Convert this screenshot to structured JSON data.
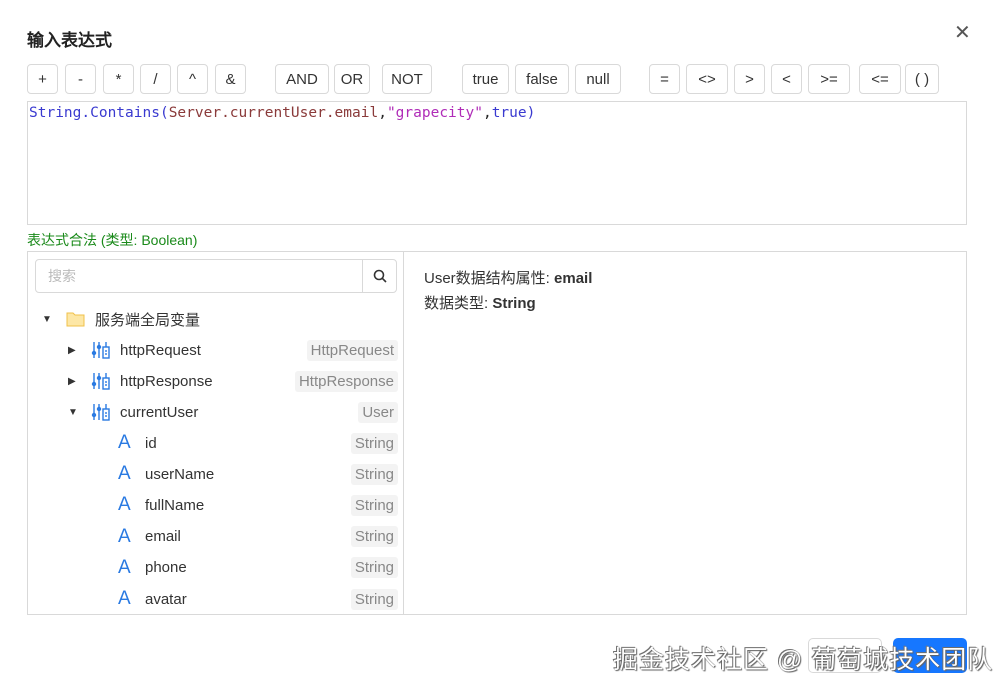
{
  "dialog": {
    "title": "输入表达式",
    "close_icon": "close-icon"
  },
  "operators": [
    "+",
    "-",
    "*",
    "/",
    "^",
    "&",
    "AND",
    "OR",
    "NOT",
    "true",
    "false",
    "null",
    "=",
    "<>",
    ">",
    "<",
    ">=",
    "<=",
    "( )"
  ],
  "expression": {
    "fn": "String.Contains(",
    "var": "Server.currentUser.email",
    "comma1": ",",
    "str": "\"grapecity\"",
    "comma2": ",",
    "bool": "true",
    "close": ")"
  },
  "validation": "表达式合法 (类型: Boolean)",
  "search": {
    "placeholder": "搜索"
  },
  "tree": {
    "root": "服务端全局变量",
    "vars": [
      {
        "name": "httpRequest",
        "type": "HttpRequest"
      },
      {
        "name": "httpResponse",
        "type": "HttpResponse"
      },
      {
        "name": "currentUser",
        "type": "User"
      }
    ],
    "fields": [
      {
        "name": "id",
        "type": "String"
      },
      {
        "name": "userName",
        "type": "String"
      },
      {
        "name": "fullName",
        "type": "String"
      },
      {
        "name": "email",
        "type": "String"
      },
      {
        "name": "phone",
        "type": "String"
      },
      {
        "name": "avatar",
        "type": "String"
      }
    ]
  },
  "detail": {
    "prop_label": "User数据结构属性: ",
    "prop_value": "email",
    "type_label": "数据类型: ",
    "type_value": "String"
  },
  "watermark": "掘金技术社区 @ 葡萄城技术团队",
  "colors": {
    "primary": "#1677ff",
    "valid": "#1a8a1a"
  }
}
